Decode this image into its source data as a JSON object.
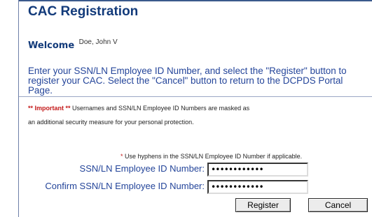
{
  "page": {
    "title": "CAC Registration",
    "welcome_label": "Welcome",
    "user_name": "Doe, John V"
  },
  "instructions": {
    "line1": "Enter your SSN/LN Employee ID Number, and select the \"Register\" button to",
    "line2": "register your CAC. Select the \"Cancel\" button to return to the DCPDS Portal",
    "line3": "Page."
  },
  "notice": {
    "important_label": "** Important **",
    "line1_rest": " Usernames and SSN/LN Employee ID Numbers are masked as",
    "line2": "an additional security measure for your personal protection."
  },
  "hint": {
    "star": "*",
    "text": " Use hyphens in the SSN/LN Employee ID Number if applicable."
  },
  "form": {
    "ssn_label": "SSN/LN Employee ID Number:",
    "ssn_value": "••••••••••••",
    "confirm_label": "Confirm SSN/LN Employee ID Number:",
    "confirm_value": "••••••••••••"
  },
  "buttons": {
    "register_label": "Register",
    "cancel_label": "Cancel"
  },
  "colors": {
    "title": "#123a7a",
    "body_text": "#24459a",
    "important": "#c41a1a"
  }
}
